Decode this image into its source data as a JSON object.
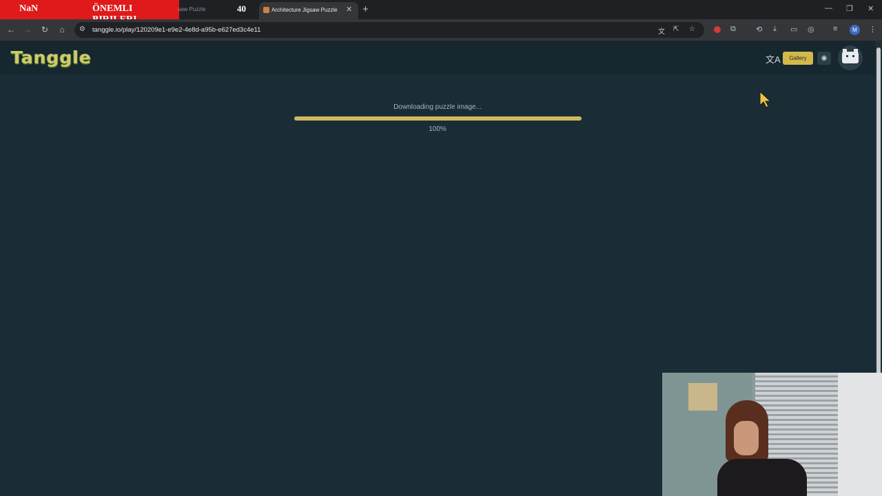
{
  "overlay": {
    "left_label": "NaN",
    "banner_text": "ÖNEMLI BIRILERI",
    "counter": "40"
  },
  "browser": {
    "inactive_tab_title": "saw Puzzle",
    "active_tab_title": "Architecture Jigsaw Puzzle",
    "url": "tanggle.io/play/120209e1-e9e2-4e8d-a95b-e627ed3c4e11",
    "profile_initial": "M"
  },
  "site": {
    "logo": "Tanggle",
    "gallery_label": "Gallery"
  },
  "loading": {
    "status_text": "Downloading puzzle image...",
    "progress_value": 100,
    "progress_label": "100%"
  },
  "colors": {
    "page_bg": "#1a2c36",
    "header_bg": "#162730",
    "accent": "#cdb95c",
    "overlay_red": "#e01a1a"
  },
  "icons": [
    "back-icon",
    "forward-icon",
    "reload-icon",
    "home-icon",
    "site-info-icon",
    "translate-icon",
    "install-icon",
    "star-icon",
    "record-icon",
    "extensions-icon",
    "history-icon",
    "download-icon",
    "devices-icon",
    "lens-icon",
    "reading-list-icon",
    "menu-icon",
    "language-icon",
    "discord-icon",
    "cat-avatar-icon"
  ]
}
